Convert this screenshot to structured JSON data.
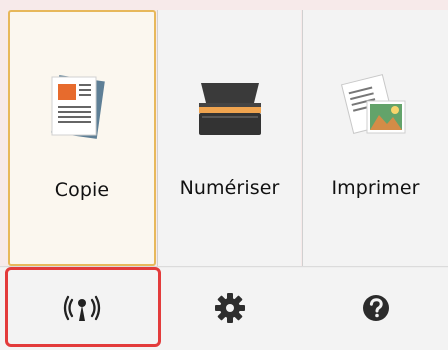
{
  "tiles": [
    {
      "label": "Copie",
      "icon": "copy-document-icon"
    },
    {
      "label": "Numériser",
      "icon": "scanner-icon"
    },
    {
      "label": "Imprimer",
      "icon": "print-photo-icon"
    }
  ],
  "bottom_bar": {
    "wireless_icon": "wireless-lan-icon",
    "settings_icon": "gear-icon",
    "help_icon": "help-icon"
  },
  "colors": {
    "background": "#f7eaea",
    "tile_background": "#f3f3f3",
    "selected_border": "#e7b85b",
    "highlight_border": "#e33b3b",
    "divider": "#d0d0d0",
    "icon_dark": "#3a3a3a",
    "document_accent": "#e76b2d",
    "photo_accent": "#63a36a"
  }
}
